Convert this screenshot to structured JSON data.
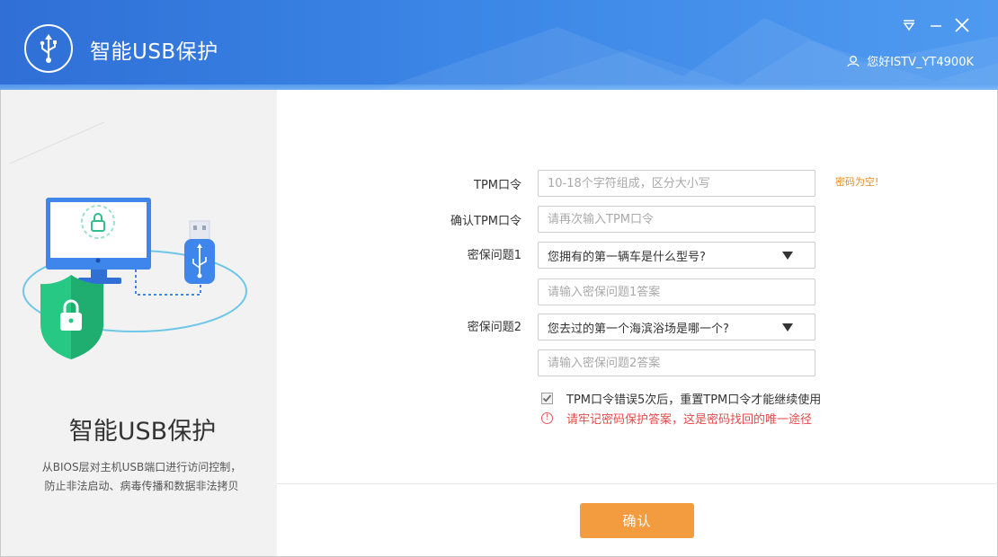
{
  "window": {
    "title": "智能USB保护",
    "user_greeting": "您好ISTV_YT4900K",
    "icons": [
      "usb-logo-icon",
      "dropdown-menu-icon",
      "minimize-icon",
      "close-icon",
      "user-icon"
    ]
  },
  "sidebar": {
    "product_name": "智能USB保护",
    "description_line1": "从BIOS层对主机USB端口进行访问控制，",
    "description_line2": "防止非法启动、病毒传播和数据非法拷贝"
  },
  "form": {
    "tpm_label": "TPM口令",
    "tpm_placeholder": "10-18个字符组成，区分大小写",
    "tpm_error": "密码为空!",
    "confirm_label": "确认TPM口令",
    "confirm_placeholder": "请再次输入TPM口令",
    "q1_label": "密保问题1",
    "q1_selected": "您拥有的第一辆车是什么型号?",
    "a1_placeholder": "请输入密保问题1答案",
    "q2_label": "密保问题2",
    "q2_selected": "您去过的第一个海滨浴场是哪一个?",
    "a2_placeholder": "请输入密保问题2答案",
    "reset_option": "TPM口令错误5次后，重置TPM口令才能继续使用",
    "reset_checked": true,
    "warning": "请牢记密码保护答案，这是密码找回的唯一途径"
  },
  "footer": {
    "confirm_button": "确认"
  },
  "colors": {
    "header_blue": "#3b86e6",
    "accent_orange": "#f29b3f",
    "error_orange": "#ee8a1c",
    "warning_red": "#e44b4b",
    "shield_green": "#2fcf8c"
  }
}
